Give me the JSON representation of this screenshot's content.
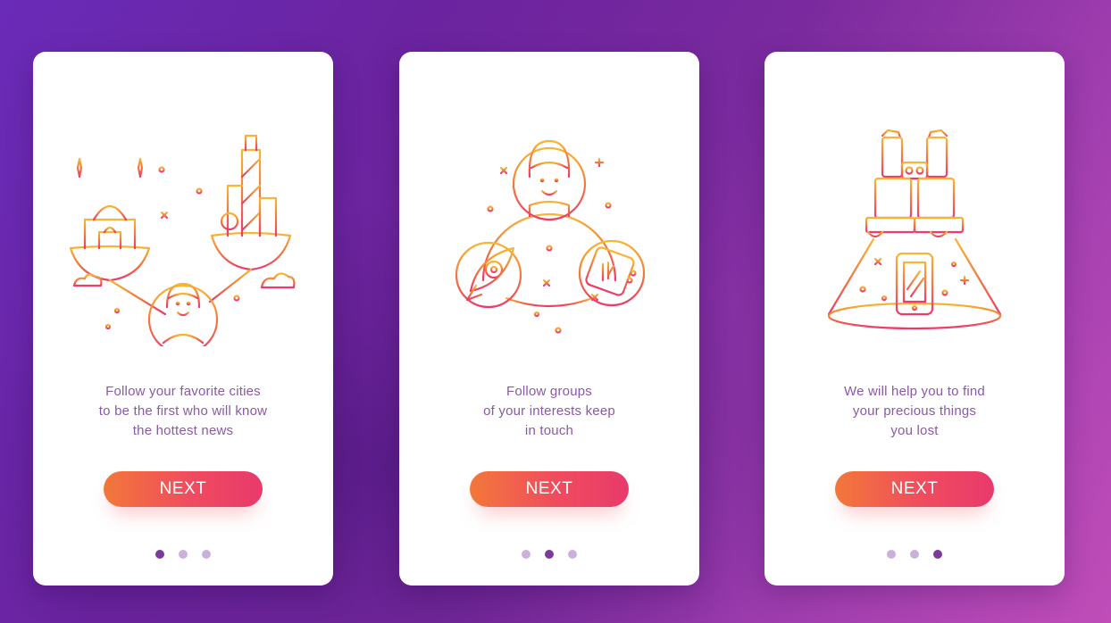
{
  "colors": {
    "background_start": "#6a2bb8",
    "background_end": "#c04db8",
    "icon_gradient_top": "#f7b733",
    "icon_gradient_bottom": "#ec3b6a",
    "caption_text": "#8a5aa6",
    "button_gradient_start": "#f2783a",
    "button_gradient_end": "#e83a6c",
    "dot_active": "#7c3a9a",
    "dot_inactive": "#cbb0dc"
  },
  "screens": [
    {
      "illustration_icon": "cities-and-person-icon",
      "caption_lines": [
        "Follow your favorite cities",
        "to be the first who will know",
        "the hottest news"
      ],
      "button_label": "NEXT",
      "active_dot": 0
    },
    {
      "illustration_icon": "person-with-interest-groups-icon",
      "caption_lines": [
        "Follow groups",
        "of your interests keep",
        "in touch"
      ],
      "button_label": "NEXT",
      "active_dot": 1
    },
    {
      "illustration_icon": "binoculars-finding-phone-icon",
      "caption_lines": [
        "We will help you to find",
        "your precious things",
        "you lost"
      ],
      "button_label": "NEXT",
      "active_dot": 2
    }
  ]
}
